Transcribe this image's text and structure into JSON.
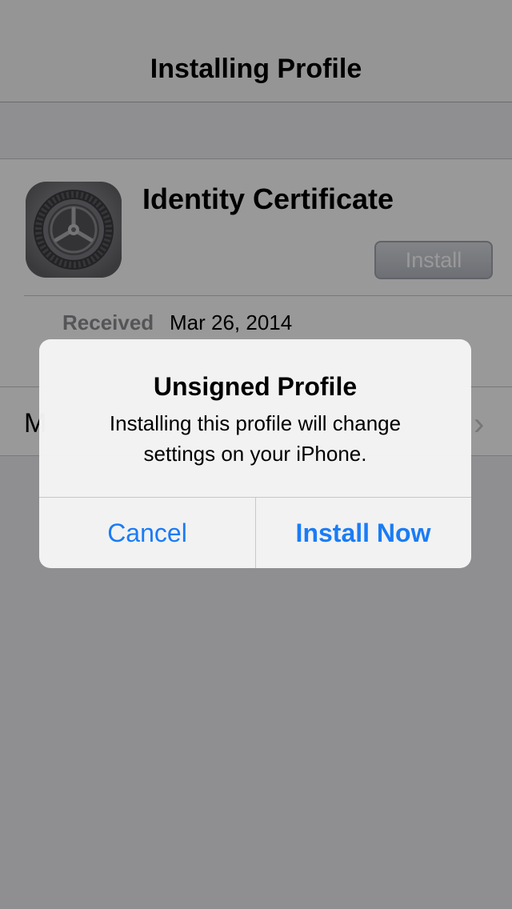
{
  "navbar": {
    "title": "Installing Profile"
  },
  "profile": {
    "icon": "settings-gear-icon",
    "name": "Identity Certificate",
    "install_label": "Install",
    "received_label": "Received",
    "received_value": "Mar 26, 2014",
    "more_label_visible": "M",
    "more_chevron": "›"
  },
  "alert": {
    "title": "Unsigned Profile",
    "message": "Installing this profile will change settings on your iPhone.",
    "cancel_label": "Cancel",
    "confirm_label": "Install Now"
  },
  "colors": {
    "action_blue": "#1a7cf5",
    "overlay": "rgba(0,0,0,0.4)"
  }
}
